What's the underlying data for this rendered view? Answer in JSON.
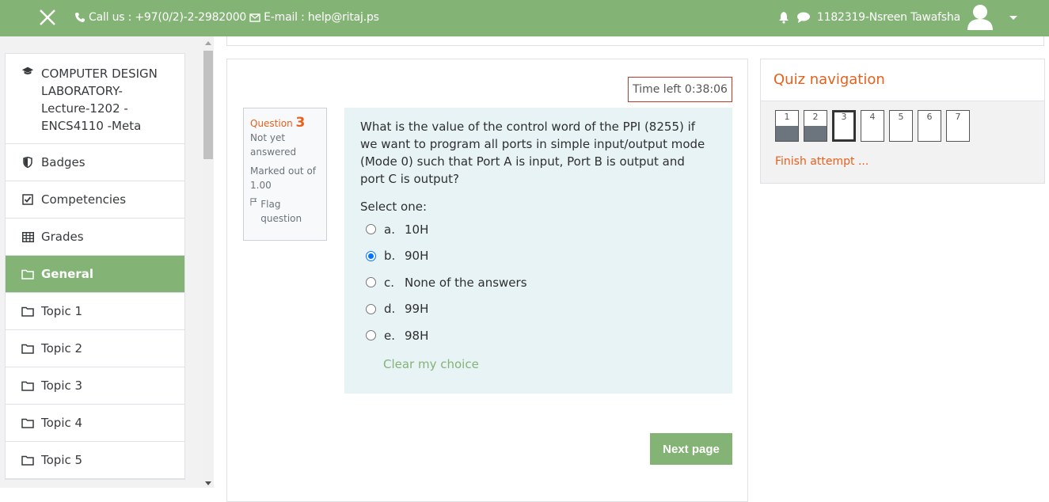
{
  "header": {
    "call_label": "Call us : +97(0/2)-2-2982000",
    "email_label": "E-mail : help@ritaj.ps",
    "user_name": "1182319-Nsreen Tawafsha"
  },
  "sidebar": {
    "course": "COMPUTER DESIGN LABORATORY-Lecture-1202 -ENCS4110 -Meta",
    "items": [
      {
        "label": "Badges"
      },
      {
        "label": "Competencies"
      },
      {
        "label": "Grades"
      },
      {
        "label": "General"
      },
      {
        "label": "Topic 1"
      },
      {
        "label": "Topic 2"
      },
      {
        "label": "Topic 3"
      },
      {
        "label": "Topic 4"
      },
      {
        "label": "Topic 5"
      }
    ]
  },
  "quiz": {
    "time_left": "Time left 0:38:06",
    "question_label": "Question",
    "question_number": "3",
    "status": "Not yet answered",
    "marked": "Marked out of 1.00",
    "flag": "Flag question",
    "text": "What is the value of the control word of the PPI (8255) if we want to program all ports in simple input/output mode (Mode 0) such that Port A is input, Port B is output and port C is output?",
    "select_one": "Select one:",
    "options": [
      {
        "letter": "a.",
        "text": "10H"
      },
      {
        "letter": "b.",
        "text": "90H"
      },
      {
        "letter": "c.",
        "text": "None of the answers"
      },
      {
        "letter": "d.",
        "text": "99H"
      },
      {
        "letter": "e.",
        "text": "98H"
      }
    ],
    "selected_option": "b.",
    "clear_choice": "Clear my choice",
    "next_page": "Next page"
  },
  "quiz_nav": {
    "title": "Quiz navigation",
    "buttons": [
      "1",
      "2",
      "3",
      "4",
      "5",
      "6",
      "7"
    ],
    "finish": "Finish attempt ..."
  },
  "colors": {
    "brand_green": "#84b376",
    "accent_orange": "#e8601c",
    "question_bg": "#e7f3f5",
    "timer_border": "#c0392b"
  }
}
